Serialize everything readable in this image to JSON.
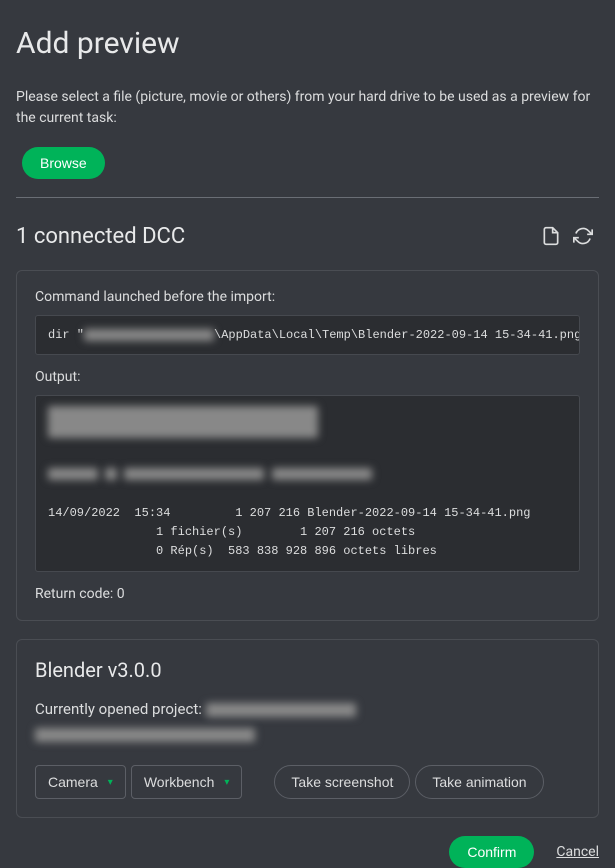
{
  "title": "Add preview",
  "instruction": "Please select a file (picture, movie or others) from your hard drive to be used as a preview for the current task:",
  "browse": "Browse",
  "dcc_header": "1 connected DCC",
  "command_panel": {
    "label": "Command launched before the import:",
    "command_prefix": "dir \"",
    "command_suffix": "\\AppData\\Local\\Temp\\Blender-2022-09-14 15-34-41.png\"",
    "output_label": "Output:",
    "output_line1": "14/09/2022  15:34         1 207 216 Blender-2022-09-14 15-34-41.png",
    "output_line2": "               1 fichier(s)        1 207 216 octets",
    "output_line3": "               0 Rép(s)  583 838 928 896 octets libres",
    "return_label": "Return code: ",
    "return_value": "0"
  },
  "dcc": {
    "name": "Blender v3.0.0",
    "project_label": "Currently opened project: ",
    "camera": "Camera",
    "renderer": "Workbench",
    "screenshot_btn": "Take screenshot",
    "animation_btn": "Take animation"
  },
  "footer": {
    "confirm": "Confirm",
    "cancel": "Cancel"
  }
}
